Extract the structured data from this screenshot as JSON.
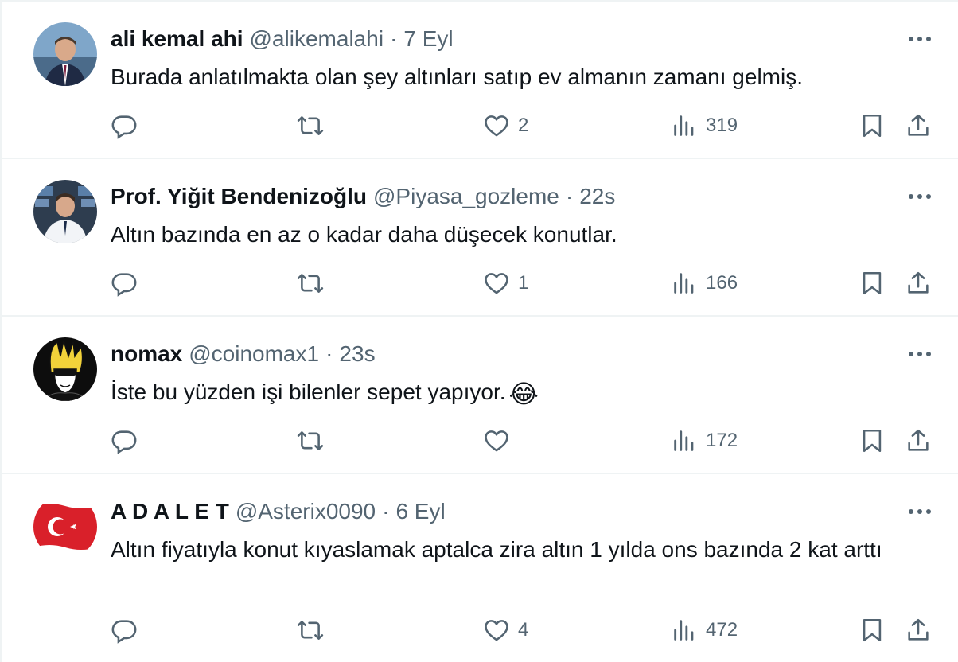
{
  "tweets": [
    {
      "name": "ali kemal ahi",
      "handle": "@alikemalahi",
      "separator": "·",
      "time": "7 Eyl",
      "text": "Burada anlatılmakta olan şey altınları satıp ev almanın zamanı gelmiş.",
      "likes": "2",
      "views": "319"
    },
    {
      "name": "Prof. Yiğit Bendenizoğlu",
      "handle": "@Piyasa_gozleme",
      "separator": "·",
      "time": "22s",
      "text": "Altın bazında en az o kadar daha düşecek konutlar.",
      "likes": "1",
      "views": "166"
    },
    {
      "name": "nomax",
      "handle": "@coinomax1",
      "separator": "·",
      "time": "23s",
      "text": "İste bu yüzden işi bilenler sepet yapıyor.",
      "emoji": "😂",
      "likes": "",
      "views": "172"
    },
    {
      "name": "A D A L E T",
      "handle": "@Asterix0090",
      "separator": "·",
      "time": "6 Eyl",
      "text": "Altın fiyatıyla konut kıyaslamak aptalca zira altın 1 yılda ons bazında 2 kat arttı",
      "likes": "4",
      "views": "472"
    }
  ],
  "colors": {
    "text_primary": "#0f1419",
    "text_secondary": "#536471",
    "divider": "#eff3f4"
  },
  "icons": [
    "more-icon",
    "reply-icon",
    "retweet-icon",
    "like-icon",
    "views-icon",
    "bookmark-icon",
    "share-icon"
  ]
}
